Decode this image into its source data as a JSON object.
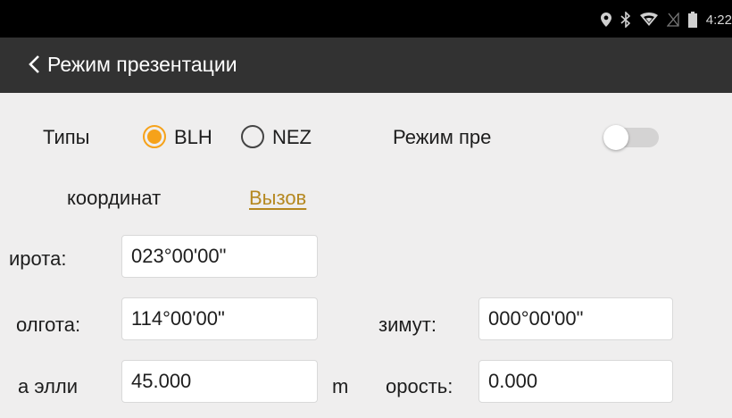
{
  "status_bar": {
    "time": "4:22",
    "icons": [
      "location-icon",
      "bluetooth-icon",
      "wifi-icon",
      "no-sim-icon",
      "battery-icon"
    ]
  },
  "app_bar": {
    "title": "Режим презентации",
    "back_icon": "chevron-left-icon"
  },
  "form": {
    "coord_types_label_line1": "Типы",
    "coord_types_label_line2": "координат",
    "option_blh": "BLH",
    "option_nez": "NEZ",
    "selected_option": "BLH",
    "presentation_mode_label": "Режим пре",
    "presentation_mode_enabled": false,
    "call_link": "Вызов",
    "latitude_label": "ирота:",
    "latitude_value": "023°00'00\"",
    "longitude_label": "олгота:",
    "longitude_value": "114°00'00\"",
    "azimuth_label": "зимут:",
    "azimuth_value": "000°00'00\"",
    "height_label": "а элли",
    "height_value": "45.000",
    "height_unit": "m",
    "speed_label": "орость:",
    "speed_value": "0.000"
  },
  "colors": {
    "accent": "#f6a21a",
    "link": "#b58820",
    "app_bar": "#323232",
    "background": "#efeeee"
  }
}
